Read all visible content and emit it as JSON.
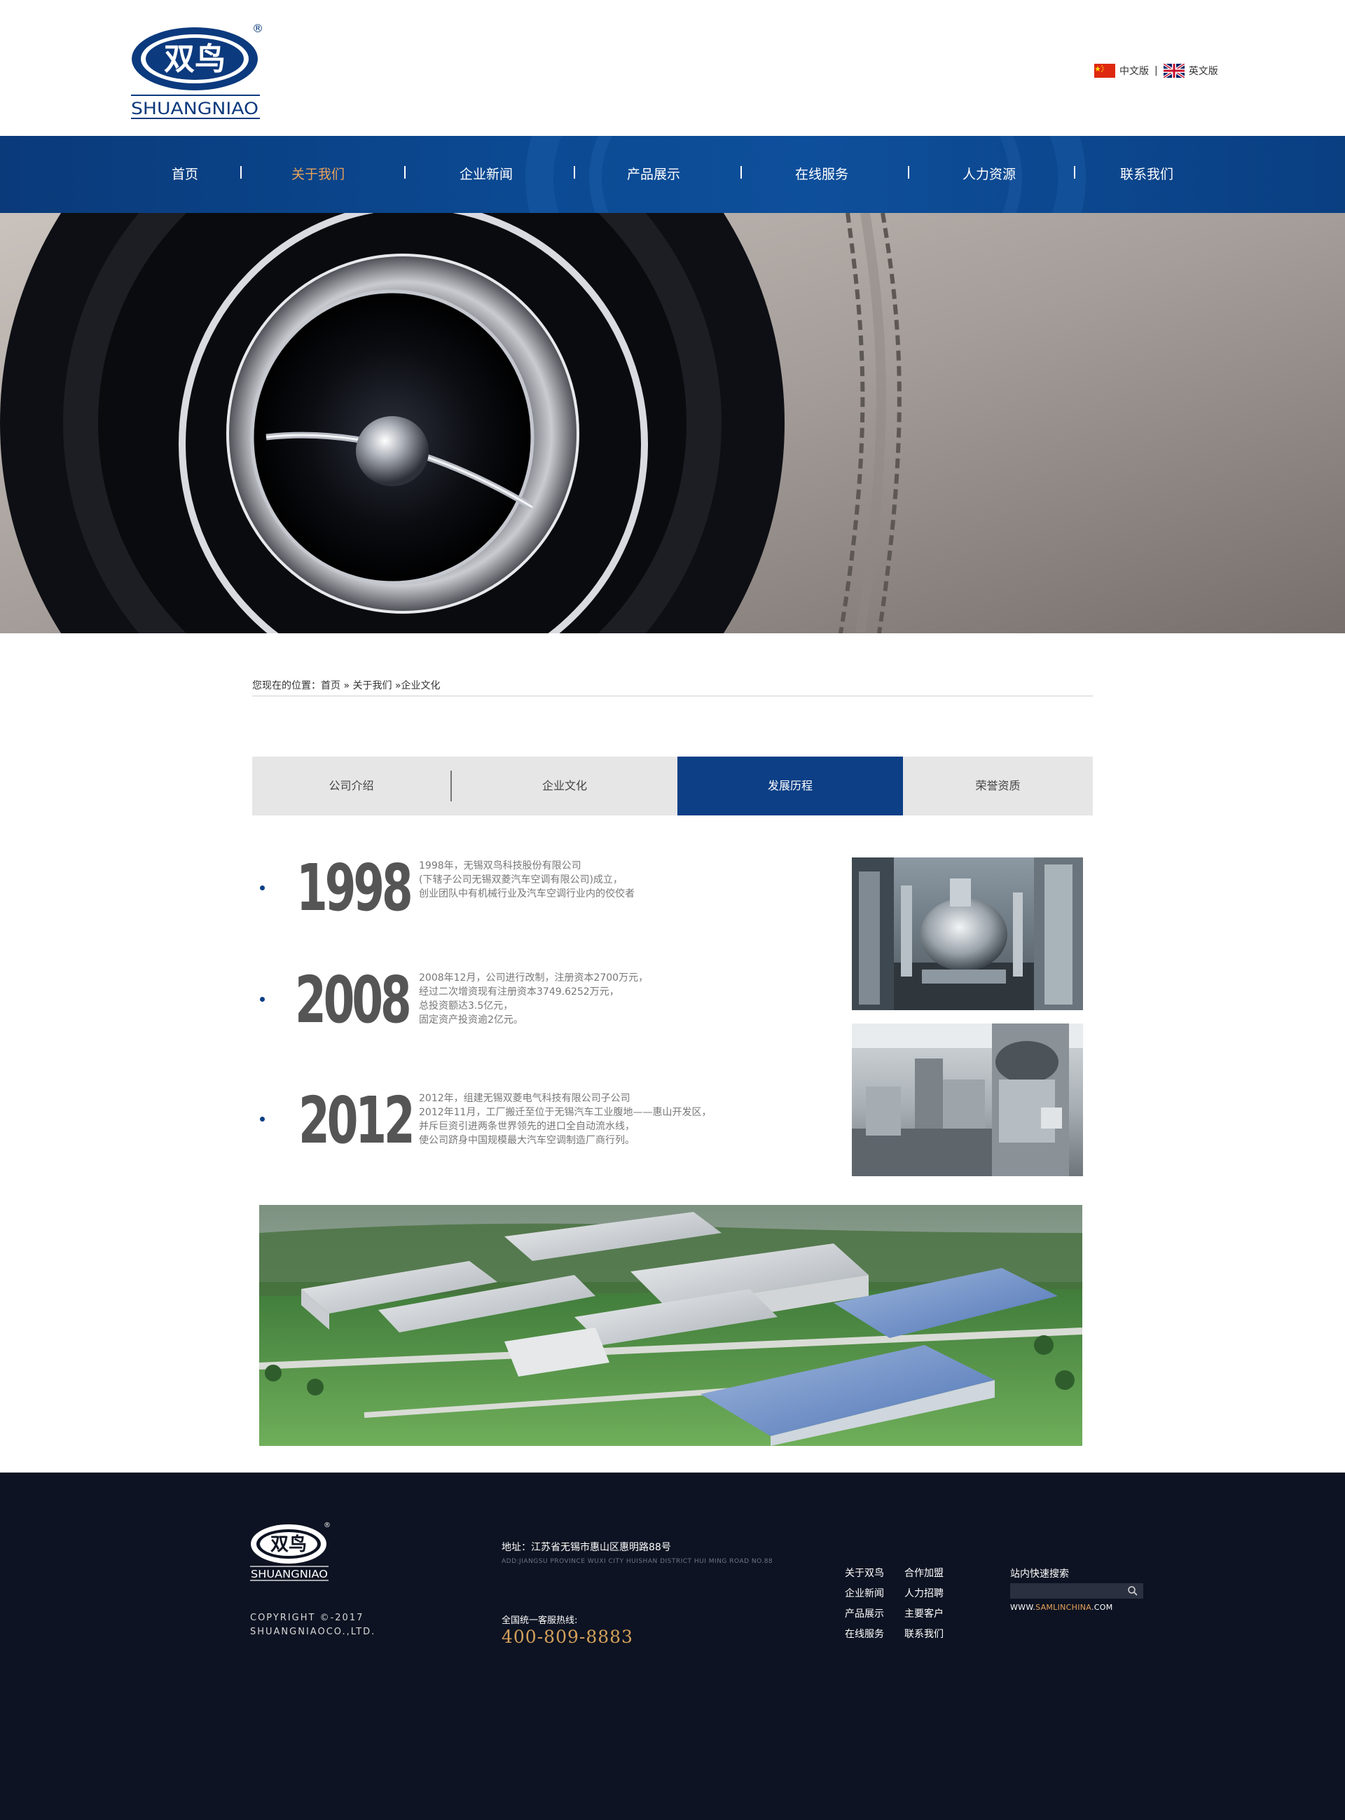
{
  "brand": {
    "logo_cn": "双鸟",
    "logo_en": "SHUANGNIAO",
    "registered": "®"
  },
  "lang": {
    "cn": "中文版",
    "sep": "|",
    "en": "英文版"
  },
  "nav": [
    {
      "label": "首页"
    },
    {
      "label": "关于我们",
      "active": true
    },
    {
      "label": "企业新闻"
    },
    {
      "label": "产品展示"
    },
    {
      "label": "在线服务"
    },
    {
      "label": "人力资源"
    },
    {
      "label": "联系我们"
    }
  ],
  "breadcrumb": {
    "prefix": "您现在的位置：",
    "home": "首页",
    "sep1": " » ",
    "about": "关于我们",
    "sep2": " »",
    "current": "企业文化"
  },
  "tabs": [
    {
      "label": "公司介绍"
    },
    {
      "label": "企业文化"
    },
    {
      "label": "发展历程",
      "active": true
    },
    {
      "label": "荣誉资质"
    }
  ],
  "timeline": [
    {
      "year": "1998",
      "lines": [
        "1998年，无锡双鸟科技股份有限公司",
        "(下辖子公司无锡双菱汽车空调有限公司)成立，",
        "创业团队中有机械行业及汽车空调行业内的佼佼者"
      ]
    },
    {
      "year": "2008",
      "lines": [
        "2008年12月，公司进行改制，注册资本2700万元，",
        "经过二次增资现有注册资本3749.6252万元，",
        "总投资额达3.5亿元，",
        "固定资产投资逾2亿元。"
      ]
    },
    {
      "year": "2012",
      "lines": [
        "2012年，组建无锡双菱电气科技有限公司子公司",
        "2012年11月，工厂搬迁至位于无锡汽车工业腹地——惠山开发区，",
        "并斥巨资引进两条世界领先的进口全自动流水线，",
        "使公司跻身中国规模最大汽车空调制造厂商行列。"
      ]
    }
  ],
  "footer": {
    "copyright_line1": "COPYRIGHT ©-2017",
    "copyright_line2": "SHUANGNIAOCO.,LTD.",
    "address": "地址：江苏省无锡市惠山区惠明路88号",
    "address_en": "ADD:JIANGSU PROVINCE WUXI CITY HUISHAN DISTRICT HUI MING ROAD NO.88",
    "hotline_label": "全国统一客服热线:",
    "hotline": "400-809-8883",
    "links_col1": [
      "关于双鸟",
      "企业新闻",
      "产品展示",
      "在线服务"
    ],
    "links_col2": [
      "合作加盟",
      "人力招聘",
      "主要客户",
      "联系我们"
    ],
    "search_label": "站内快速搜索",
    "search_placeholder": "",
    "site_prefix": "WWW.",
    "site_highlight": "SAMLINCHINA",
    "site_suffix": ".COM"
  },
  "colors": {
    "nav_blue": "#0b4a93",
    "active_orange": "#e8a35a",
    "tab_active": "#0c3f86",
    "footer_bg": "#0d1322",
    "hotline": "#d4a05a"
  },
  "icons": [
    "china-flag-icon",
    "uk-flag-icon",
    "search-icon"
  ]
}
